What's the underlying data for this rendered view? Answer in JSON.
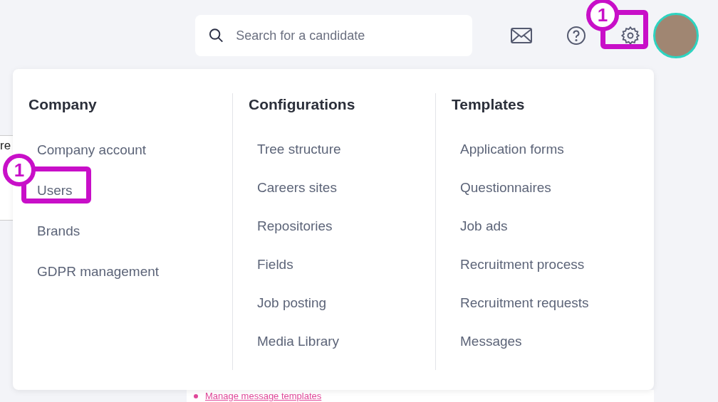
{
  "search": {
    "placeholder": "Search for a candidate"
  },
  "header": {
    "settings_annotation": "1"
  },
  "menu": {
    "columns": [
      {
        "heading": "Company",
        "items": [
          {
            "label": "Company account"
          },
          {
            "label": "Users",
            "annotation": "1"
          },
          {
            "label": "Brands"
          },
          {
            "label": "GDPR management"
          }
        ]
      },
      {
        "heading": "Configurations",
        "items": [
          {
            "label": "Tree structure"
          },
          {
            "label": "Careers sites"
          },
          {
            "label": "Repositories"
          },
          {
            "label": "Fields"
          },
          {
            "label": "Job posting"
          },
          {
            "label": "Media Library"
          }
        ]
      },
      {
        "heading": "Templates",
        "items": [
          {
            "label": "Application forms"
          },
          {
            "label": "Questionnaires"
          },
          {
            "label": "Job ads"
          },
          {
            "label": "Recruitment process"
          },
          {
            "label": "Recruitment requests"
          },
          {
            "label": "Messages"
          }
        ]
      }
    ]
  },
  "background": {
    "fragment": "re",
    "link": "Manage message templates"
  }
}
